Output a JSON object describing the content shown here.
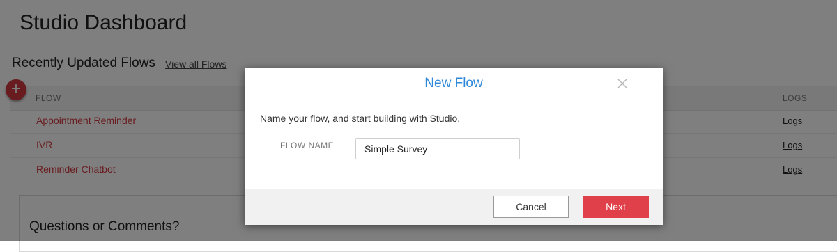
{
  "page": {
    "title": "Studio Dashboard",
    "section_title": "Recently Updated Flows",
    "view_all_label": "View all Flows",
    "add_button_symbol": "+",
    "columns": {
      "flow": "FLOW",
      "logs": "LOGS"
    },
    "flows": [
      {
        "name": "Appointment Reminder",
        "logs": "Logs"
      },
      {
        "name": "IVR",
        "logs": "Logs"
      },
      {
        "name": "Reminder Chatbot",
        "logs": "Logs"
      }
    ],
    "questions_title": "Questions or Comments?"
  },
  "modal": {
    "title": "New Flow",
    "close_icon": "close-icon",
    "intro": "Name your flow, and start building with Studio.",
    "field_label": "FLOW NAME",
    "field_value": "Simple Survey",
    "cancel_label": "Cancel",
    "next_label": "Next"
  },
  "colors": {
    "accent_red": "#e0404a",
    "link_red": "#d2383f",
    "modal_title_blue": "#2f88d9",
    "overlay": "rgba(0,0,0,0.5)"
  }
}
